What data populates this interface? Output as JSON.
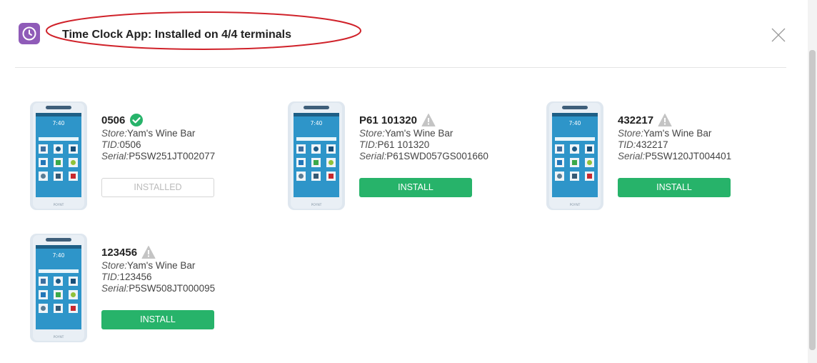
{
  "dialog": {
    "title": "Time Clock App: Installed on 4/4 terminals",
    "close_label": "Close",
    "accent_color": "#8f5bb8",
    "annotation_color": "#d0222a"
  },
  "labels": {
    "store": "Store:",
    "tid": "TID:",
    "serial": "Serial:"
  },
  "device_screen": {
    "time": "7:40",
    "brand": "POYNT"
  },
  "terminals": [
    {
      "name": "0506",
      "status": "installed",
      "status_icon": "check-circle-icon",
      "store": "Yam's Wine Bar",
      "tid": "0506",
      "serial": "P5SW251JT002077",
      "button_label": "INSTALLED"
    },
    {
      "name": "P61 101320",
      "status": "warning",
      "status_icon": "warning-icon",
      "store": "Yam's Wine Bar",
      "tid": "P61 101320",
      "serial": "P61SWD057GS001660",
      "button_label": "INSTALL"
    },
    {
      "name": "432217",
      "status": "warning",
      "status_icon": "warning-icon",
      "store": "Yam's Wine Bar",
      "tid": "432217",
      "serial": "P5SW120JT004401",
      "button_label": "INSTALL"
    },
    {
      "name": "123456",
      "status": "warning",
      "status_icon": "warning-icon",
      "store": "Yam's Wine Bar",
      "tid": "123456",
      "serial": "P5SW508JT000095",
      "button_label": "INSTALL"
    }
  ]
}
